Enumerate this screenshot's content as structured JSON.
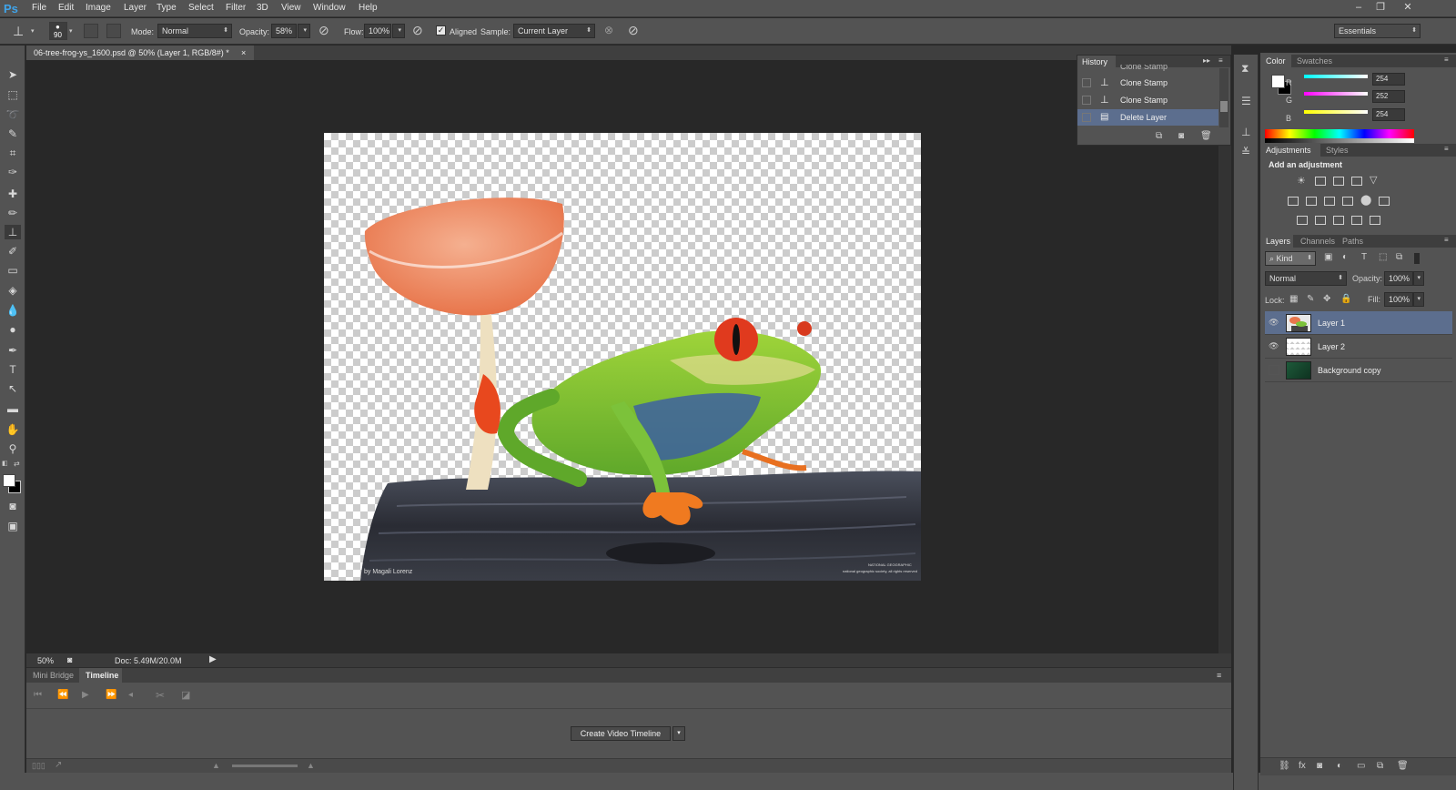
{
  "menubar": {
    "logo": "Ps",
    "items": [
      "File",
      "Edit",
      "Image",
      "Layer",
      "Type",
      "Select",
      "Filter",
      "3D",
      "View",
      "Window",
      "Help"
    ],
    "window_controls": [
      "–",
      "❐",
      "✕"
    ]
  },
  "options": {
    "brush_size": "90",
    "mode_label": "Mode:",
    "mode_value": "Normal",
    "opacity_label": "Opacity:",
    "opacity_value": "58%",
    "flow_label": "Flow:",
    "flow_value": "100%",
    "aligned_label": "Aligned",
    "sample_label": "Sample:",
    "sample_value": "Current Layer",
    "workspace": "Essentials"
  },
  "document": {
    "tab_title": "06-tree-frog-ys_1600.psd @ 50% (Layer 1, RGB/8#) *",
    "close": "×",
    "credit_left": "by Magali Lorenz",
    "credit_right": "NATIONAL GEOGRAPHIC",
    "credit_right2": "national geographic society, all rights reserved"
  },
  "status": {
    "zoom": "50%",
    "doc_info": "Doc: 5.49M/20.0M"
  },
  "bottom": {
    "tabs": [
      "Mini Bridge",
      "Timeline"
    ],
    "create_button": "Create Video Timeline"
  },
  "history": {
    "title": "History",
    "items": [
      "Clone Stamp",
      "Clone Stamp",
      "Clone Stamp",
      "Delete Layer"
    ]
  },
  "color_panel": {
    "tabs": [
      "Color",
      "Swatches"
    ],
    "channels": [
      {
        "label": "R",
        "value": "254",
        "color": "#00d8ff"
      },
      {
        "label": "G",
        "value": "252",
        "color": "#ff3ae0"
      },
      {
        "label": "B",
        "value": "254",
        "color": "#ffff00"
      }
    ]
  },
  "adjustments": {
    "tabs": [
      "Adjustments",
      "Styles"
    ],
    "heading": "Add an adjustment"
  },
  "layers": {
    "tabs": [
      "Layers",
      "Channels",
      "Paths"
    ],
    "filter": "Kind",
    "blend_mode": "Normal",
    "opacity_label": "Opacity:",
    "opacity_value": "100%",
    "lock_label": "Lock:",
    "fill_label": "Fill:",
    "fill_value": "100%",
    "items": [
      {
        "name": "Layer 1",
        "visible": true,
        "selected": true
      },
      {
        "name": "Layer 2",
        "visible": true,
        "selected": false
      },
      {
        "name": "Background copy",
        "visible": false,
        "selected": false
      }
    ]
  }
}
